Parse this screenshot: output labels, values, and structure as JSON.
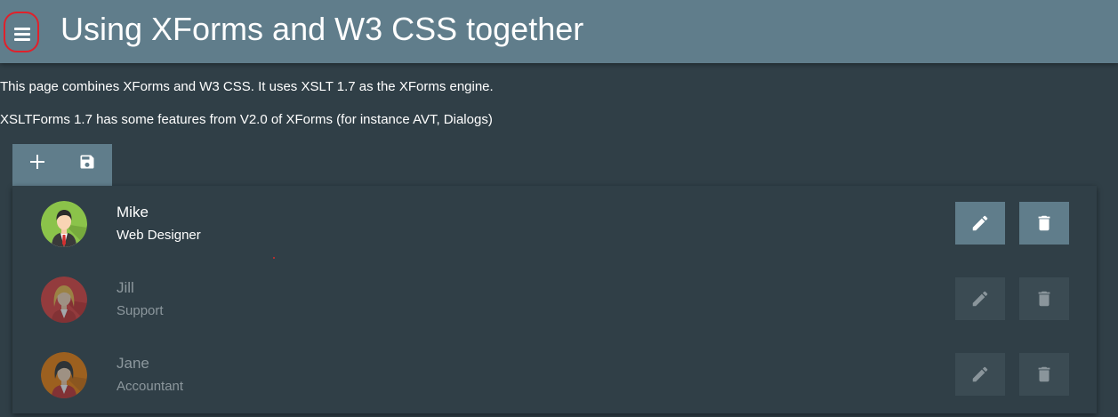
{
  "header": {
    "title": "Using XForms and W3 CSS together",
    "menu_icon": "hamburger-menu-icon",
    "background_color": "#607d8b",
    "menu_outline_color": "#e0212b"
  },
  "intro": {
    "line1": "This page combines XForms and W3 CSS. It uses XSLT 1.7 as the XForms engine.",
    "line2": "XSLTForms 1.7 has some features from V2.0 of XForms (for instance AVT, Dialogs)"
  },
  "toolbar": {
    "add_icon": "plus-icon",
    "save_icon": "floppy-disk-icon"
  },
  "people": [
    {
      "name": "Mike",
      "role": "Web Designer",
      "active": true,
      "avatar_bg": "#8bc34a",
      "avatar_icon": "male-avatar-icon"
    },
    {
      "name": "Jill",
      "role": "Support",
      "active": false,
      "avatar_bg": "#e53935",
      "avatar_icon": "female-avatar-icon"
    },
    {
      "name": "Jane",
      "role": "Accountant",
      "active": false,
      "avatar_bg": "#f57c00",
      "avatar_icon": "female-avatar-icon"
    }
  ],
  "row_actions": {
    "edit_icon": "pencil-icon",
    "delete_icon": "trash-icon"
  },
  "colors": {
    "page_background": "#303f47",
    "button_active": "#607d8b",
    "button_inactive": "#3b4b53"
  }
}
